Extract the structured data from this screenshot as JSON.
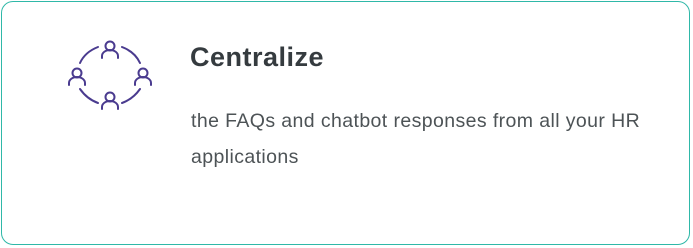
{
  "card": {
    "icon": "network-people-icon",
    "title": "Centralize",
    "description": "the FAQs and chatbot responses from all your HR applications"
  },
  "colors": {
    "border": "#2fb8a8",
    "icon": "#4a3b8f",
    "title": "#353b3f",
    "text": "#4d5356"
  }
}
